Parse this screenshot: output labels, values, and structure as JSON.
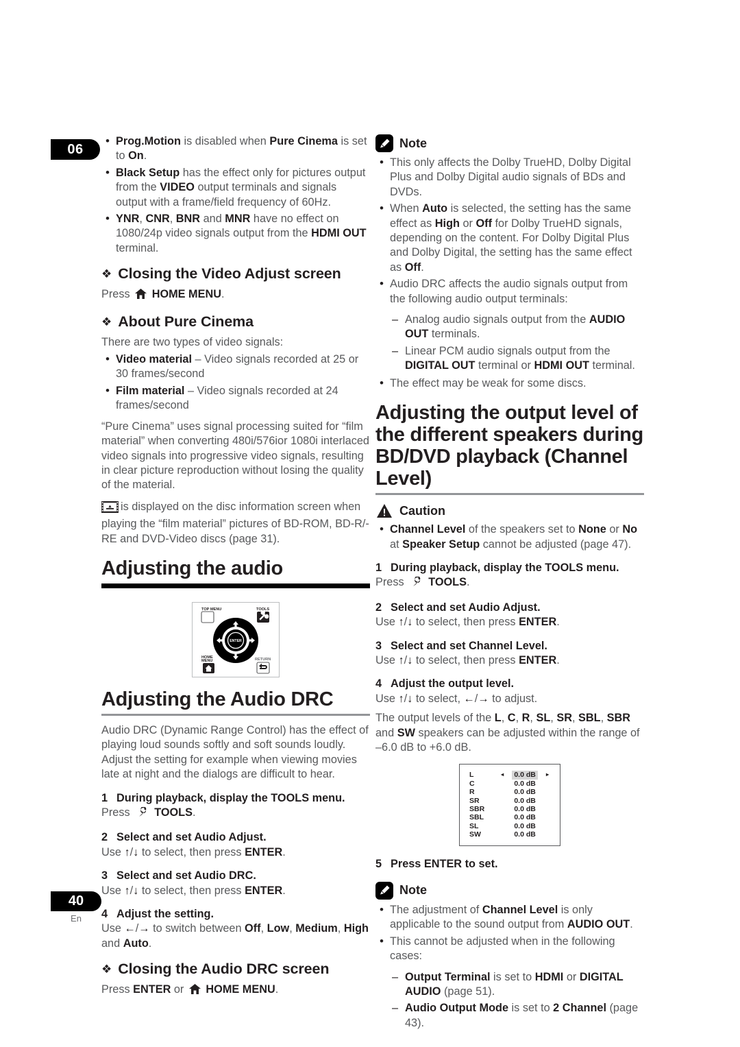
{
  "chapter": {
    "number": "06"
  },
  "footer": {
    "page": "40",
    "language": "En"
  },
  "left": {
    "top_bullets": [
      "<b>Prog.Motion</b> is disabled when <b>Pure Cinema</b> is set to <b>On</b>.",
      "<b>Black Setup</b> has the effect only for pictures output from the <b>VIDEO</b> output terminals and signals output with a frame/field frequency of 60Hz.",
      "<b>YNR</b>, <b>CNR</b>, <b>BNR</b> and <b>MNR</b> have no effect on 1080/24p video signals output from the <b>HDMI OUT</b> terminal."
    ],
    "closing_video_adjust": {
      "heading": "Closing the Video Adjust screen",
      "press_prefix": "Press",
      "home_menu_label": "HOME MENU",
      "period": "."
    },
    "about_pure_cinema": {
      "heading": "About Pure Cinema",
      "intro": "There are two types of video signals:",
      "bullets": [
        "<b>Video material</b> – Video signals recorded at 25 or  30 frames/second",
        "<b>Film material</b> – Video signals recorded at 24 frames/second"
      ],
      "paragraph": "“Pure Cinema” uses signal processing suited for “film material” when converting 480i/576ior 1080i interlaced video signals into progressive video signals, resulting in clear picture reproduction without losing the quality of the material.",
      "film_paragraph": "is displayed on the disc information screen when playing the “film material” pictures of BD-ROM, BD-R/-RE and DVD-Video discs (page 31)."
    },
    "adjusting_audio_title": "Adjusting the audio",
    "remote": {
      "top_menu": "TOP MENU",
      "tools": "TOOLS",
      "home_menu": "HOME\nMENU",
      "return": "RETURN",
      "enter": "ENTER"
    },
    "audio_drc": {
      "heading": "Adjusting the Audio DRC",
      "intro": "Audio DRC (Dynamic Range Control) has the effect of playing loud sounds softly and soft sounds loudly. Adjust the setting for example when viewing movies late at night and the dialogs are difficult to hear.",
      "steps": [
        {
          "num": "1",
          "title": "During playback, display the TOOLS menu.",
          "detail_html": "Press&nbsp;&nbsp;<span class=\"tools-slot\"></span>&nbsp;<b>TOOLS</b>."
        },
        {
          "num": "2",
          "title": "Select and set Audio Adjust.",
          "detail_html": "Use <b>↑</b>/<b>↓</b> to select, then press <b>ENTER</b>."
        },
        {
          "num": "3",
          "title": "Select and set Audio DRC.",
          "detail_html": "Use <b>↑</b>/<b>↓</b> to select, then press <b>ENTER</b>."
        },
        {
          "num": "4",
          "title": "Adjust the setting.",
          "detail_html": "Use <b>←</b>/<b>→</b> to switch between <b>Off</b>, <b>Low</b>, <b>Medium</b>, <b>High</b> and <b>Auto</b>."
        }
      ],
      "closing": {
        "heading": "Closing the Audio DRC screen",
        "press_prefix": "Press",
        "enter_label": "ENTER",
        "or_label": "or",
        "home_menu_label": "HOME MENU",
        "period": "."
      }
    }
  },
  "right": {
    "note1": {
      "label": "Note",
      "bullets": [
        "This only affects the Dolby TrueHD, Dolby Digital Plus and Dolby Digital audio signals of BDs and DVDs.",
        "When <b>Auto</b> is selected, the setting has the same effect as <b>High</b> or <b>Off</b> for Dolby TrueHD signals, depending on the content. For Dolby Digital Plus and Dolby Digital, the setting has the same effect as <b>Off</b>.",
        "Audio DRC affects the audio signals output from the following audio output terminals:"
      ],
      "dashes": [
        "Analog audio signals output from the <b>AUDIO OUT</b> terminals.",
        "Linear PCM audio signals output from the <b>DIGITAL OUT</b> terminal or <b>HDMI OUT</b> terminal."
      ],
      "last_bullet": "The effect may be weak for some discs."
    },
    "channel_level": {
      "heading": "Adjusting the output level of the different speakers during BD/DVD playback (Channel Level)",
      "caution": {
        "label": "Caution",
        "bullets": [
          "<b>Channel Level</b> of the speakers set to <b>None</b> or <b>No</b> at <b>Speaker Setup</b> cannot be adjusted (page 47)."
        ]
      },
      "steps": [
        {
          "num": "1",
          "title": "During playback, display the TOOLS menu.",
          "detail_html": "Press&nbsp;&nbsp;<span class=\"tools-slot\"></span>&nbsp;<b>TOOLS</b>."
        },
        {
          "num": "2",
          "title": "Select and set Audio Adjust.",
          "detail_html": "Use <b>↑</b>/<b>↓</b> to select, then press <b>ENTER</b>."
        },
        {
          "num": "3",
          "title": "Select and set Channel Level.",
          "detail_html": "Use <b>↑</b>/<b>↓</b> to select, then press <b>ENTER</b>."
        },
        {
          "num": "4",
          "title": "Adjust the output level.",
          "detail_html": "Use <b>↑</b>/<b>↓</b> to select, <b>←</b>/<b>→</b> to adjust."
        }
      ],
      "range_paragraph": "The output levels of the <b>L</b>, <b>C</b>, <b>R</b>, <b>SL</b>, <b>SR</b>, <b>SBL</b>, <b>SBR</b> and <b>SW</b> speakers can be adjusted within the range of –6.0 dB to +6.0 dB.",
      "osd": {
        "rows": [
          {
            "channel": "L",
            "value": "0.0 dB",
            "selected": true
          },
          {
            "channel": "C",
            "value": "0.0 dB",
            "selected": false
          },
          {
            "channel": "R",
            "value": "0.0 dB",
            "selected": false
          },
          {
            "channel": "SR",
            "value": "0.0 dB",
            "selected": false
          },
          {
            "channel": "SBR",
            "value": "0.0 dB",
            "selected": false
          },
          {
            "channel": "SBL",
            "value": "0.0 dB",
            "selected": false
          },
          {
            "channel": "SL",
            "value": "0.0 dB",
            "selected": false
          },
          {
            "channel": "SW",
            "value": "0.0 dB",
            "selected": false
          }
        ],
        "left_caret": "◂",
        "right_caret": "▸"
      },
      "step5": {
        "num": "5",
        "title": "Press ENTER to set."
      },
      "note2": {
        "label": "Note",
        "bullets": [
          "The adjustment of <b>Channel Level</b> is only applicable to the sound output from <b>AUDIO OUT</b>.",
          "This cannot be adjusted when in the following cases:"
        ],
        "dashes": [
          "<b>Output Terminal</b> is set to <b>HDMI</b> or <b>DIGITAL AUDIO</b> (page 51).",
          "<b>Audio Output Mode</b> is set to <b>2 Channel</b> (page 43)."
        ]
      }
    }
  }
}
